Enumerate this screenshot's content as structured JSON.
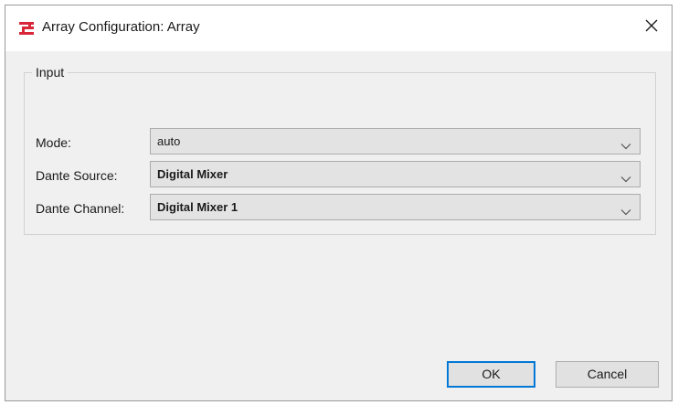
{
  "window": {
    "title": "Array Configuration: Array",
    "app_icon": "mixer-logo-icon",
    "close_icon": "close-icon",
    "accent_color": "#d9273a"
  },
  "input_group": {
    "label": "Input",
    "fields": [
      {
        "label": "Mode:",
        "value": "auto"
      },
      {
        "label": "Dante Source:",
        "value": "Digital Mixer"
      },
      {
        "label": "Dante Channel:",
        "value": "Digital Mixer 1"
      }
    ]
  },
  "buttons": {
    "ok_label": "OK",
    "cancel_label": "Cancel",
    "default_border_color": "#0078d7"
  }
}
